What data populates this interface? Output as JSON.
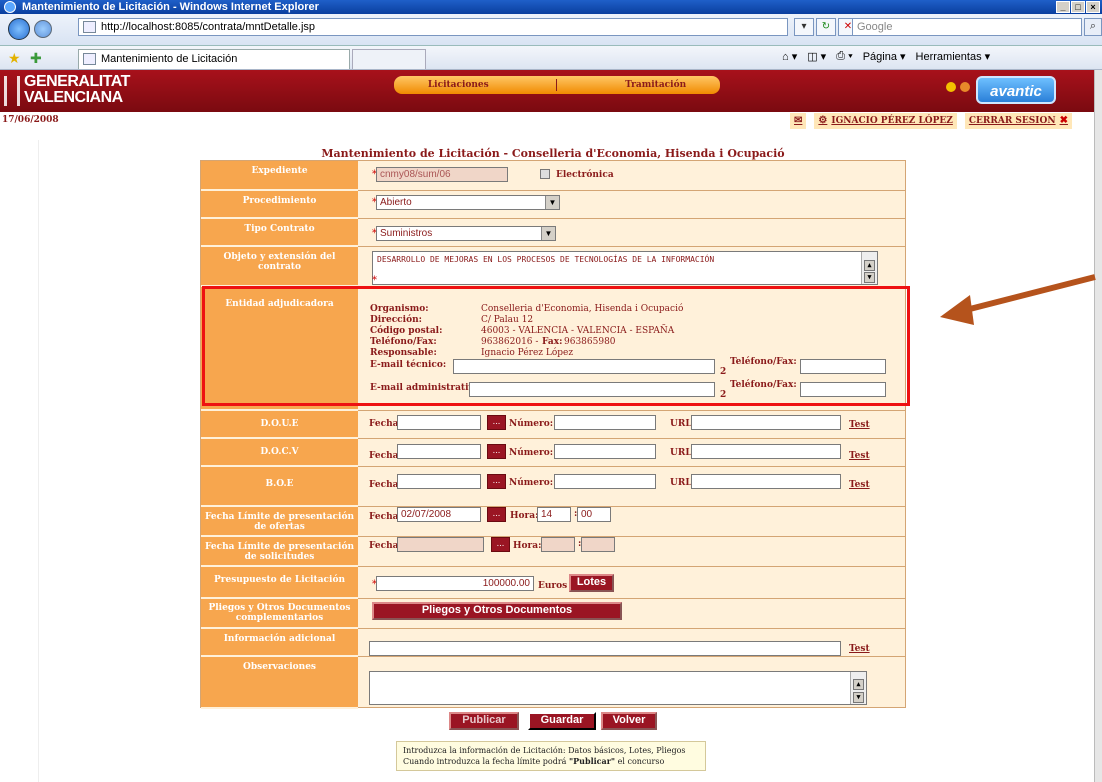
{
  "browser": {
    "window_title": "Mantenimiento de Licitación - Windows Internet Explorer",
    "url": "http://localhost:8085/contrata/mntDetalle.jsp",
    "search_placeholder": "Google",
    "tab_title": "Mantenimiento de Licitación",
    "commands": [
      "Página",
      "Herramientas"
    ]
  },
  "header": {
    "logo_line1": "GENERALITAT",
    "logo_line2": "VALENCIANA",
    "menu": [
      "Licitaciones",
      "Tramitación"
    ],
    "brand": "avantic"
  },
  "date": "17/06/2008",
  "user": {
    "name": "IGNACIO PÉREZ LÓPEZ",
    "logout": "CERRAR SESION"
  },
  "page_title": "Mantenimiento de Licitación - Conselleria d'Economia, Hisenda i Ocupació",
  "form": {
    "labels": {
      "expediente": "Expediente",
      "procedimiento": "Procedimiento",
      "tipo_contrato": "Tipo Contrato",
      "objeto": "Objeto y extensión del contrato",
      "entidad": "Entidad adjudicadora",
      "doue": "D.O.U.E",
      "docv": "D.O.C.V",
      "boe": "B.O.E",
      "limite_ofertas": "Fecha Límite de presentación de ofertas",
      "limite_solicitudes": "Fecha Límite de presentación de solicitudes",
      "presupuesto": "Presupuesto de Licitación",
      "pliegos": "Pliegos y Otros Documentos complementarios",
      "info": "Información adicional",
      "observaciones": "Observaciones"
    },
    "expediente_value": "cnmy08/sum/06",
    "electronica_label": "Electrónica",
    "procedimiento_value": "Abierto",
    "tipo_contrato_value": "Suministros",
    "objeto_value": "DESARROLLO DE MEJORAS EN LOS PROCESOS DE TECNOLOGÍAS DE LA INFORMACIÓN",
    "entidad": {
      "organismo_label": "Organismo:",
      "organismo": "Conselleria d'Economia, Hisenda i Ocupació",
      "direccion_label": "Dirección:",
      "direccion": "C/ Palau 12",
      "cp_label": "Código postal:",
      "cp": "46003 - VALENCIA - VALENCIA - ESPAÑA",
      "telfax_label": "Teléfono/Fax:",
      "telefono": "963862016 -",
      "fax_label": "Fax:",
      "fax": "963865980",
      "responsable_label": "Responsable:",
      "responsable": "Ignacio Pérez López",
      "email_tecnico_label": "E-mail técnico:",
      "email_admin_label": "E-mail administrativo:",
      "telfax2_label": "Teléfono/Fax:",
      "marker": "2"
    },
    "pub": {
      "fecha": "Fecha",
      "numero": "Número:",
      "url": "URL:",
      "test": "Test",
      "cal": "..."
    },
    "ofertas": {
      "fecha": "02/07/2008",
      "hora_label": "Hora:",
      "hora": "14",
      "min": "00",
      "sep": ":"
    },
    "presupuesto_value": "100000.00",
    "euros": "Euros",
    "lotes_button": "Lotes",
    "pliegos_button": "Pliegos y Otros Documentos",
    "info_test": "Test"
  },
  "actions": {
    "publicar": "Publicar",
    "guardar": "Guardar",
    "volver": "Volver"
  },
  "note": {
    "line1": "Introduzca la información de Licitación: Datos básicos, Lotes, Pliegos",
    "line2_pre": "Cuando introduzca la fecha límite podrá ",
    "line2_bold": "\"Publicar\"",
    "line2_post": " el concurso"
  },
  "colors": {
    "brand_red": "#9a1523",
    "label_orange": "#f7a64e",
    "highlight": "#ee1111",
    "arrow": "#b5531c"
  }
}
